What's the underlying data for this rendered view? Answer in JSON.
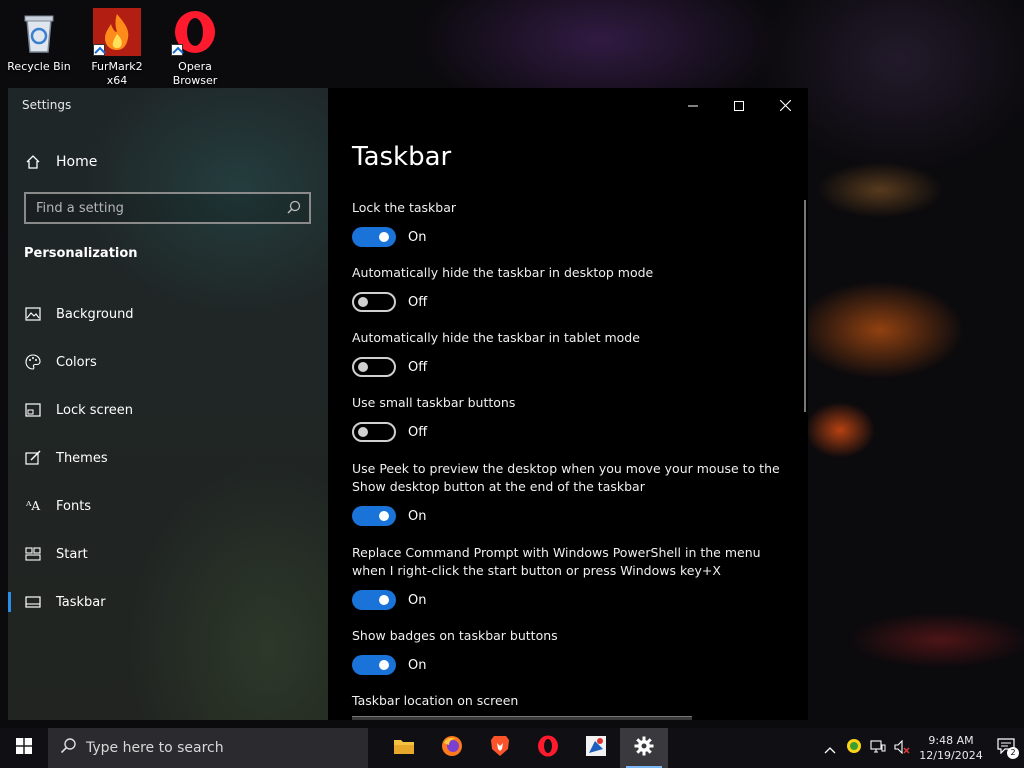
{
  "desktop_icons": [
    {
      "label": "Recycle Bin",
      "icon": "recycle-bin-icon"
    },
    {
      "label": "FurMark2 x64",
      "icon": "furmark-icon"
    },
    {
      "label": "Opera Browser",
      "icon": "opera-icon"
    }
  ],
  "window": {
    "title": "Settings",
    "controls": {
      "minimize": "minimize-icon",
      "maximize": "maximize-icon",
      "close": "close-icon"
    }
  },
  "sidebar": {
    "home_label": "Home",
    "search_placeholder": "Find a setting",
    "section_heading": "Personalization",
    "items": [
      {
        "label": "Background",
        "icon": "background-icon"
      },
      {
        "label": "Colors",
        "icon": "palette-icon"
      },
      {
        "label": "Lock screen",
        "icon": "lock-screen-icon"
      },
      {
        "label": "Themes",
        "icon": "themes-icon"
      },
      {
        "label": "Fonts",
        "icon": "fonts-icon"
      },
      {
        "label": "Start",
        "icon": "start-icon"
      },
      {
        "label": "Taskbar",
        "icon": "taskbar-icon",
        "active": true
      }
    ]
  },
  "main": {
    "title": "Taskbar",
    "settings": [
      {
        "label": "Lock the taskbar",
        "state": "On",
        "on": true
      },
      {
        "label": "Automatically hide the taskbar in desktop mode",
        "state": "Off",
        "on": false
      },
      {
        "label": "Automatically hide the taskbar in tablet mode",
        "state": "Off",
        "on": false
      },
      {
        "label": "Use small taskbar buttons",
        "state": "Off",
        "on": false
      },
      {
        "label_line1": "Use Peek to preview the desktop when you move your mouse to the",
        "label_line2": "Show desktop button at the end of the taskbar",
        "state": "On",
        "on": true
      },
      {
        "label_line1": "Replace Command Prompt with Windows PowerShell in the menu",
        "label_line2": "when I right-click the start button or press Windows key+X",
        "state": "On",
        "on": true
      },
      {
        "label": "Show badges on taskbar buttons",
        "state": "On",
        "on": true
      }
    ],
    "location_label": "Taskbar location on screen"
  },
  "taskbar": {
    "search_placeholder": "Type here to search",
    "pinned": [
      {
        "name": "file-explorer-icon"
      },
      {
        "name": "firefox-icon"
      },
      {
        "name": "brave-icon"
      },
      {
        "name": "opera-icon"
      },
      {
        "name": "paint-icon"
      },
      {
        "name": "settings-gear-icon",
        "active": true
      }
    ],
    "tray": {
      "time": "9:48 AM",
      "date": "12/19/2024",
      "notification_count": "2"
    }
  },
  "colors": {
    "accent": "#1a73d9",
    "active_indicator": "#2a8dea"
  }
}
